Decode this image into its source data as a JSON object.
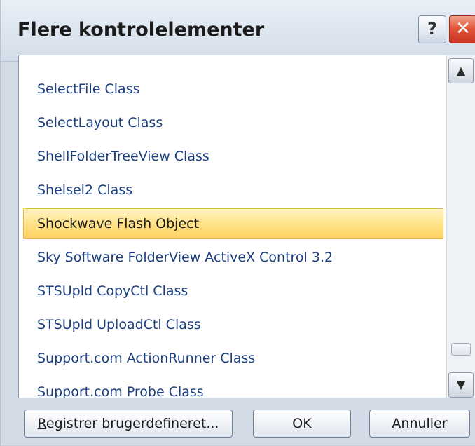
{
  "window": {
    "title": "Flere kontrolelementer",
    "help_label": "?",
    "close_label": "✕"
  },
  "list": {
    "items": [
      {
        "label": "SelectFile Class",
        "selected": false
      },
      {
        "label": "SelectLayout Class",
        "selected": false
      },
      {
        "label": "ShellFolderTreeView Class",
        "selected": false
      },
      {
        "label": "Shelsel2 Class",
        "selected": false
      },
      {
        "label": "Shockwave Flash Object",
        "selected": true
      },
      {
        "label": "Sky Software FolderView ActiveX Control 3.2",
        "selected": false
      },
      {
        "label": "STSUpld CopyCtl Class",
        "selected": false
      },
      {
        "label": "STSUpld UploadCtl Class",
        "selected": false
      },
      {
        "label": "Support.com ActionRunner Class",
        "selected": false
      },
      {
        "label": "Support.com Probe Class",
        "selected": false
      }
    ],
    "scroll_up_glyph": "▲",
    "scroll_down_glyph": "▼"
  },
  "buttons": {
    "register_label": "Registrer brugerdefineret...",
    "ok_label": "OK",
    "cancel_label": "Annuller"
  },
  "colors": {
    "item_text": "#1c3f80",
    "selection_fill": "#ffe48e",
    "close_button": "#e2573d"
  }
}
